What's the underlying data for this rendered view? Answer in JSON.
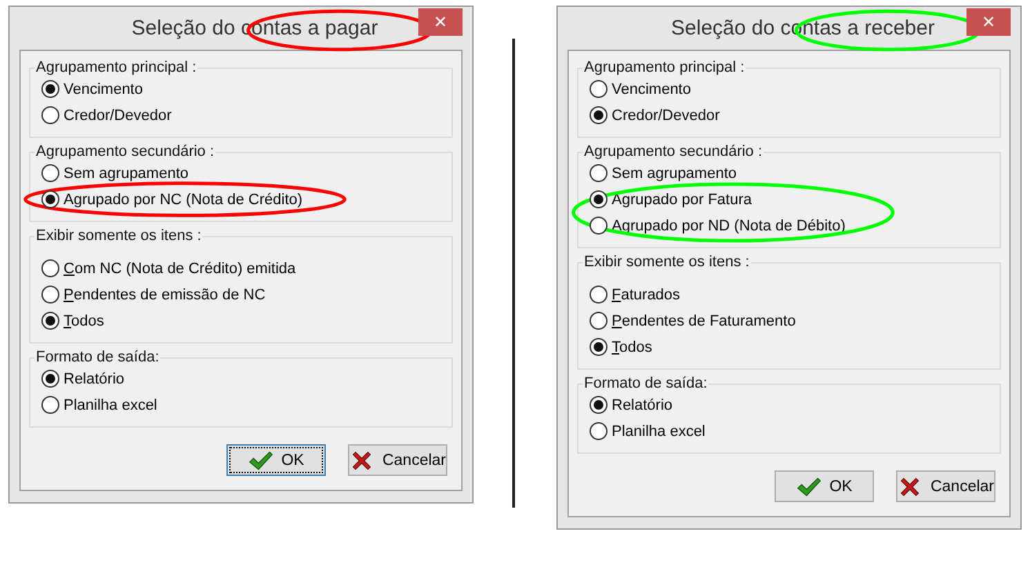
{
  "dialogs": [
    {
      "title": "Seleção do contas a pagar",
      "title_circled": true,
      "color": "#ff0000",
      "close": "✕",
      "groups": [
        {
          "label": "Agrupamento principal :",
          "options": [
            {
              "label": "Vencimento",
              "selected": true,
              "circled": false,
              "mnemonic": false
            },
            {
              "label": "Credor/Devedor",
              "selected": false,
              "circled": false,
              "mnemonic": false
            }
          ]
        },
        {
          "label": "Agrupamento secundário :",
          "options": [
            {
              "label": "Sem agrupamento",
              "selected": false,
              "circled": false,
              "mnemonic": false
            },
            {
              "label": "Agrupado por NC (Nota de Crédito)",
              "selected": true,
              "circled": true,
              "mnemonic": false
            }
          ]
        },
        {
          "label": "Exibir somente os itens :",
          "options": [
            {
              "label": "Com NC (Nota de Crédito) emitida",
              "selected": false,
              "circled": false,
              "mnemonic": true
            },
            {
              "label": "Pendentes de emissão de NC",
              "selected": false,
              "circled": false,
              "mnemonic": true
            },
            {
              "label": "Todos",
              "selected": true,
              "circled": false,
              "mnemonic": true
            }
          ]
        },
        {
          "label": "Formato de saída:",
          "options": [
            {
              "label": "Relatório",
              "selected": true,
              "circled": false,
              "mnemonic": false
            },
            {
              "label": "Planilha excel",
              "selected": false,
              "circled": false,
              "mnemonic": false
            }
          ]
        }
      ],
      "buttons": [
        {
          "label": "OK",
          "kind": "ok",
          "focused": true
        },
        {
          "label": "Cancelar",
          "kind": "cancel",
          "focused": false
        }
      ]
    },
    {
      "title": "Seleção do contas a receber",
      "title_circled": true,
      "color": "#00ff00",
      "close": "✕",
      "groups": [
        {
          "label": "Agrupamento principal :",
          "options": [
            {
              "label": "Vencimento",
              "selected": false,
              "circled": false,
              "mnemonic": false
            },
            {
              "label": "Credor/Devedor",
              "selected": true,
              "circled": false,
              "mnemonic": false
            }
          ]
        },
        {
          "label": "Agrupamento secundário :",
          "options": [
            {
              "label": "Sem agrupamento",
              "selected": false,
              "circled": false,
              "mnemonic": false
            },
            {
              "label": "Agrupado por Fatura",
              "selected": true,
              "circled": true,
              "mnemonic": false
            },
            {
              "label": "Agrupado por ND (Nota de Débito)",
              "selected": false,
              "circled": true,
              "mnemonic": false
            }
          ]
        },
        {
          "label": "Exibir somente os itens :",
          "options": [
            {
              "label": "Faturados",
              "selected": false,
              "circled": false,
              "mnemonic": true
            },
            {
              "label": "Pendentes de Faturamento",
              "selected": false,
              "circled": false,
              "mnemonic": true
            },
            {
              "label": "Todos",
              "selected": true,
              "circled": false,
              "mnemonic": true
            }
          ]
        },
        {
          "label": "Formato de saída:",
          "options": [
            {
              "label": "Relatório",
              "selected": true,
              "circled": false,
              "mnemonic": false
            },
            {
              "label": "Planilha excel",
              "selected": false,
              "circled": false,
              "mnemonic": false
            }
          ]
        }
      ],
      "buttons": [
        {
          "label": "OK",
          "kind": "ok",
          "focused": false
        },
        {
          "label": "Cancelar",
          "kind": "cancel",
          "focused": false
        }
      ]
    }
  ]
}
